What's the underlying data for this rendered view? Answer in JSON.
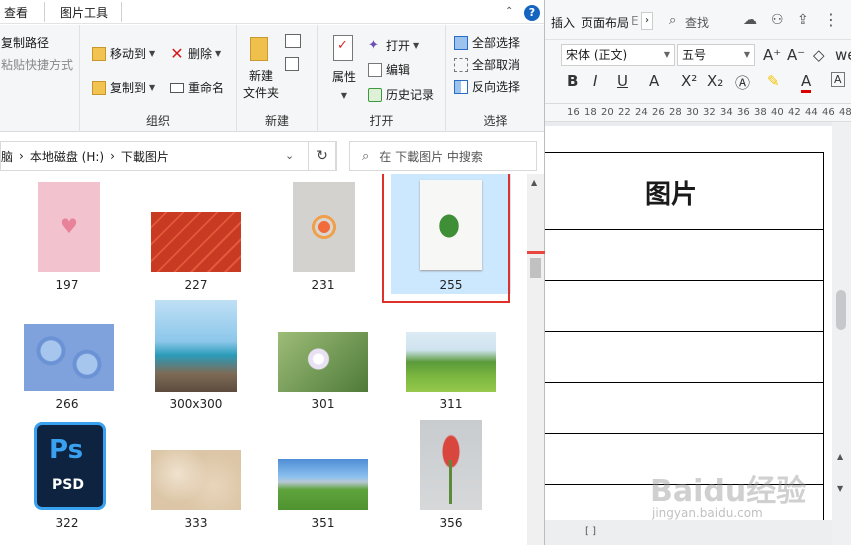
{
  "explorer": {
    "tabs": [
      "查看",
      "图片工具"
    ],
    "ribbon": {
      "clipboard": {
        "copy_path": "复制路径",
        "paste_shortcut": "粘贴快捷方式"
      },
      "organize": {
        "label": "组织",
        "move_to": "移动到",
        "copy_to": "复制到",
        "delete": "删除",
        "rename": "重命名"
      },
      "new": {
        "label": "新建",
        "new_folder": "新建\n文件夹"
      },
      "open": {
        "label": "打开",
        "properties": "属性",
        "open": "打开",
        "edit": "编辑",
        "history": "历史记录"
      },
      "select": {
        "label": "选择",
        "select_all": "全部选择",
        "select_none": "全部取消",
        "invert": "反向选择"
      }
    },
    "address": {
      "crumbs": [
        "脑",
        "本地磁盘 (H:)",
        "下載图片"
      ],
      "separator": "›"
    },
    "search": {
      "placeholder": "在 下載图片 中搜索"
    },
    "files": [
      {
        "name": "197",
        "thumb": "pink-heart"
      },
      {
        "name": "227",
        "thumb": "red-brick"
      },
      {
        "name": "231",
        "thumb": "fruit-flatlay"
      },
      {
        "name": "255",
        "thumb": "green-leaf",
        "selected": true
      },
      {
        "name": "266",
        "thumb": "blue-hydrangea"
      },
      {
        "name": "300x300",
        "thumb": "seaside"
      },
      {
        "name": "301",
        "thumb": "daisies"
      },
      {
        "name": "311",
        "thumb": "green-hill"
      },
      {
        "name": "322",
        "thumb": "psd-icon",
        "icon_text": "Ps",
        "icon_sub": "PSD"
      },
      {
        "name": "333",
        "thumb": "fur"
      },
      {
        "name": "351",
        "thumb": "meadow"
      },
      {
        "name": "356",
        "thumb": "tulips"
      }
    ]
  },
  "word": {
    "menu": {
      "insert": "插入",
      "layout": "页面布局",
      "more": "E",
      "search": "查找"
    },
    "font": {
      "name": "宋体 (正文)",
      "size": "五号"
    },
    "format_buttons": [
      "B",
      "I",
      "U",
      "A",
      "X²",
      "X₂",
      "A"
    ],
    "ruler": [
      "16",
      "18",
      "20",
      "22",
      "24",
      "26",
      "28",
      "30",
      "32",
      "34",
      "36",
      "38",
      "40",
      "42",
      "44",
      "46",
      "48"
    ],
    "doc": {
      "title": "图片"
    },
    "status": "[ ]"
  },
  "watermark": {
    "text": "Baidu经验",
    "sub": "jingyan.baidu.com"
  },
  "colors": {
    "selection": "#cce8ff",
    "highlight_box": "#e0302a",
    "arrow": "#e8473f",
    "ribbon_bg": "#f5f6f7"
  }
}
